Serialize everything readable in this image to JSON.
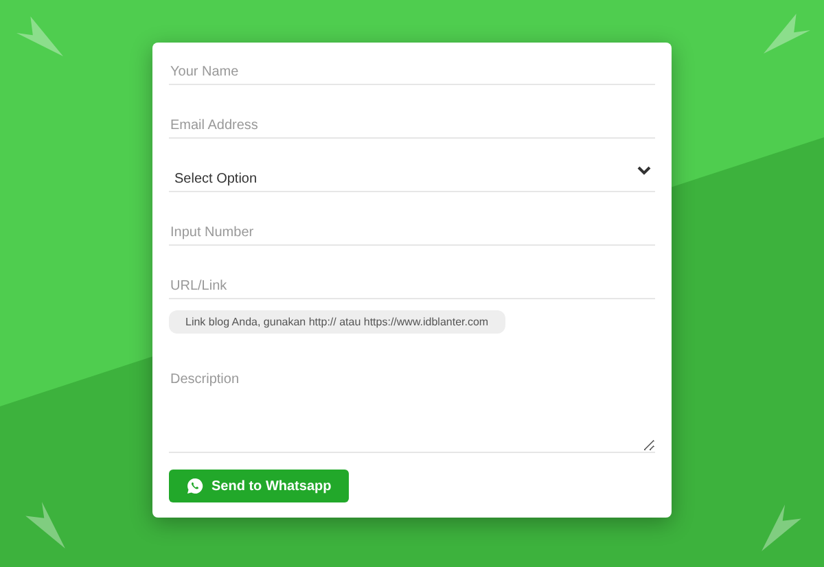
{
  "form": {
    "fields": [
      {
        "kind": "text",
        "placeholder": "Your Name"
      },
      {
        "kind": "text",
        "placeholder": "Email Address"
      },
      {
        "kind": "select",
        "value": "Select Option"
      },
      {
        "kind": "text",
        "placeholder": "Input Number"
      },
      {
        "kind": "text",
        "placeholder": "URL/Link"
      },
      {
        "kind": "hint",
        "text": "Link blog Anda, gunakan http:// atau https://www.idblanter.com"
      },
      {
        "kind": "textarea",
        "placeholder": "Description"
      }
    ],
    "submit": "Send to Whatsapp"
  }
}
